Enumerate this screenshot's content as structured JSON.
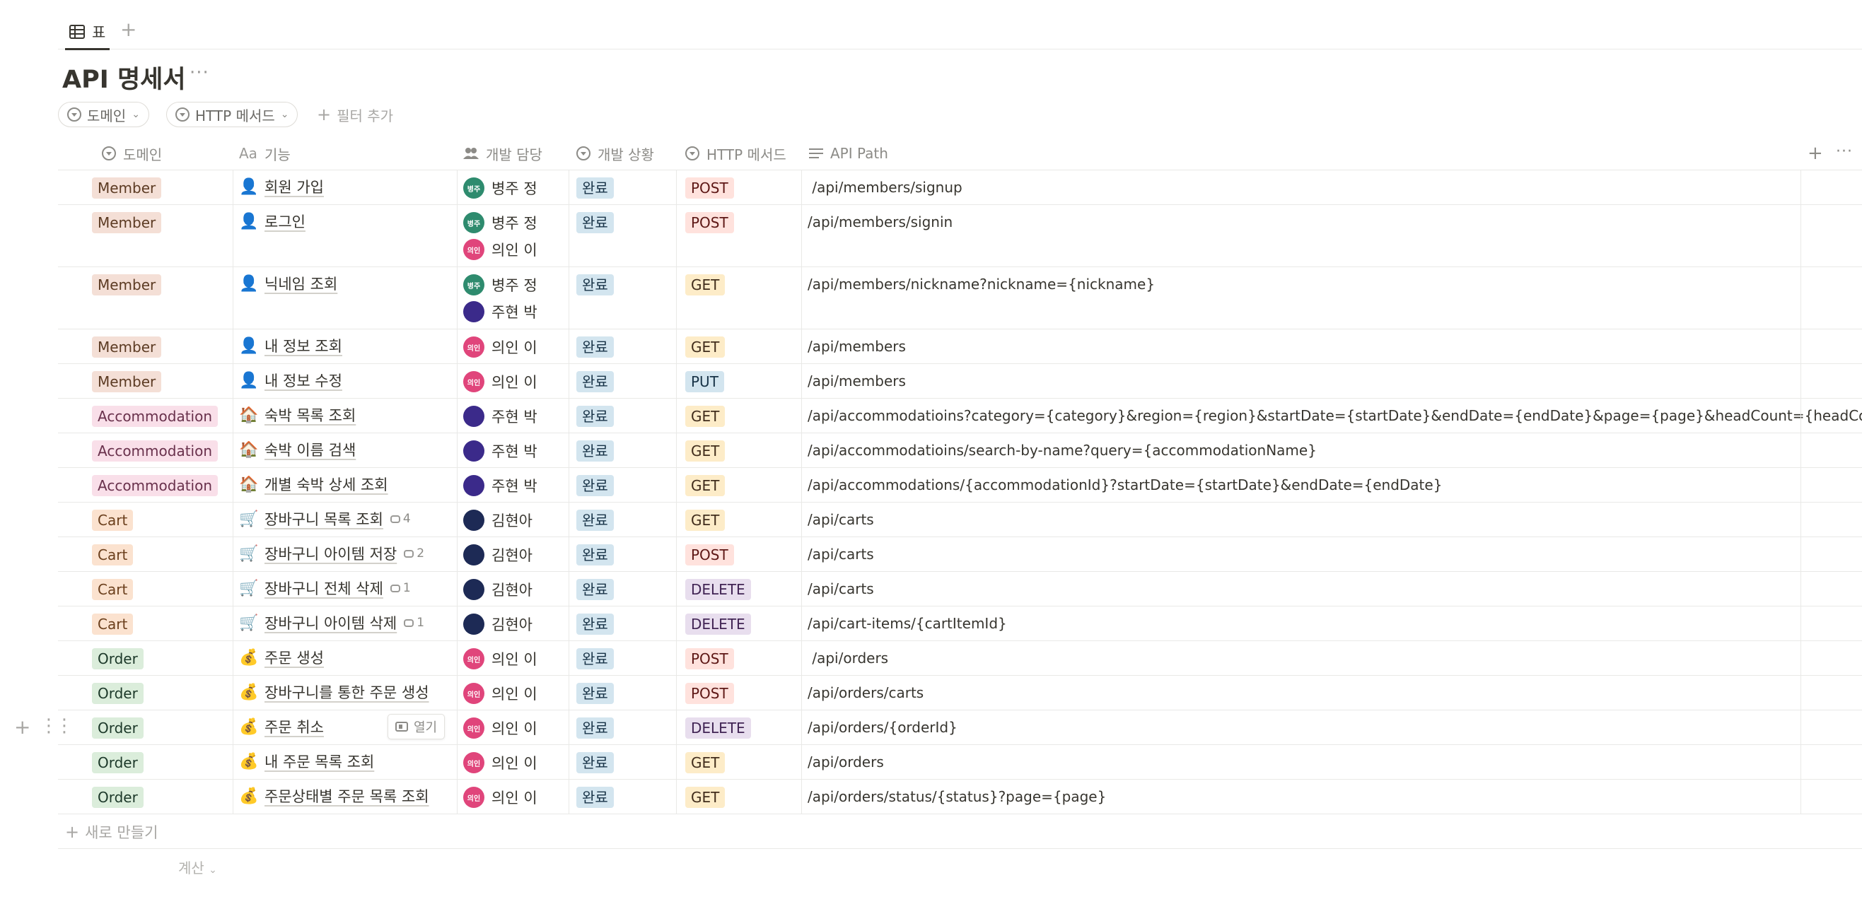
{
  "view": {
    "tab_label": "표",
    "add": "+"
  },
  "page": {
    "title": "API 명세서",
    "more": "···"
  },
  "filters": [
    {
      "label": "도메인"
    },
    {
      "label": "HTTP 메서드"
    }
  ],
  "add_filter": "필터 추가",
  "columns": [
    {
      "label": "도메인",
      "icon": "select-icon"
    },
    {
      "label": "기능",
      "prefix": "Aa",
      "icon": "title-icon"
    },
    {
      "label": "개발 담당",
      "icon": "people-icon"
    },
    {
      "label": "개발 상황",
      "icon": "select-icon"
    },
    {
      "label": "HTTP 메서드",
      "icon": "select-icon"
    },
    {
      "label": "API Path",
      "icon": "text-icon"
    }
  ],
  "people": {
    "jung": {
      "name": "병주 정",
      "initials": "병주",
      "color": "#2e8b6e"
    },
    "lee": {
      "name": "의인 이",
      "initials": "의인",
      "color": "#e0457b"
    },
    "park": {
      "name": "주현 박",
      "initials": "",
      "color": "#3b2a8a"
    },
    "kim": {
      "name": "김현아",
      "initials": "",
      "color": "#1d2a55"
    }
  },
  "domain_colors": {
    "Member": {
      "bg": "#f4dfd6",
      "fg": "#5c3b23"
    },
    "Accommodation": {
      "bg": "#f9dfe9",
      "fg": "#69314c"
    },
    "Cart": {
      "bg": "#fbe2cf",
      "fg": "#6b3f1c"
    },
    "Order": {
      "bg": "#dbeddb",
      "fg": "#1c3829"
    }
  },
  "method_colors": {
    "POST": {
      "bg": "#ffe2dd",
      "fg": "#5d1715"
    },
    "GET": {
      "bg": "#fdecc8",
      "fg": "#402c1b"
    },
    "PUT": {
      "bg": "#d3e5ef",
      "fg": "#183347"
    },
    "DELETE": {
      "bg": "#e8deee",
      "fg": "#412454"
    }
  },
  "status_color": {
    "bg": "#d3e5ef",
    "fg": "#183347"
  },
  "rows": [
    {
      "domain": "Member",
      "emoji": "👤",
      "name": "회원 가입",
      "devs": [
        "jung"
      ],
      "status": "완료",
      "method": "POST",
      "path": " /api/members/signup"
    },
    {
      "domain": "Member",
      "emoji": "👤",
      "name": "로그인",
      "devs": [
        "jung",
        "lee"
      ],
      "status": "완료",
      "method": "POST",
      "path": "/api/members/signin"
    },
    {
      "domain": "Member",
      "emoji": "👤",
      "name": "닉네임 조회",
      "devs": [
        "jung",
        "park"
      ],
      "status": "완료",
      "method": "GET",
      "path": "/api/members/nickname?nickname={nickname}"
    },
    {
      "domain": "Member",
      "emoji": "👤",
      "name": "내 정보 조회",
      "devs": [
        "lee"
      ],
      "status": "완료",
      "method": "GET",
      "path": "/api/members"
    },
    {
      "domain": "Member",
      "emoji": "👤",
      "name": "내 정보 수정",
      "devs": [
        "lee"
      ],
      "status": "완료",
      "method": "PUT",
      "path": "/api/members"
    },
    {
      "domain": "Accommodation",
      "emoji": "🏠",
      "name": "숙박 목록 조회",
      "devs": [
        "park"
      ],
      "status": "완료",
      "method": "GET",
      "path": "/api/accommodatioins?category={category}&region={region}&startDate={startDate}&endDate={endDate}&page={page}&headCount={headCount}"
    },
    {
      "domain": "Accommodation",
      "emoji": "🏠",
      "name": "숙박 이름 검색",
      "devs": [
        "park"
      ],
      "status": "완료",
      "method": "GET",
      "path": "/api/accommodatioins/search-by-name?query={accommodationName}"
    },
    {
      "domain": "Accommodation",
      "emoji": "🏠",
      "name": "개별 숙박 상세 조회",
      "devs": [
        "park"
      ],
      "status": "완료",
      "method": "GET",
      "path": "/api/accommodations/{accommodationId}?startDate={startDate}&endDate={endDate}"
    },
    {
      "domain": "Cart",
      "emoji": "🛒",
      "name": "장바구니 목록 조회",
      "comments": "4",
      "devs": [
        "kim"
      ],
      "status": "완료",
      "method": "GET",
      "path": "/api/carts"
    },
    {
      "domain": "Cart",
      "emoji": "🛒",
      "name": "장바구니 아이템 저장",
      "comments": "2",
      "devs": [
        "kim"
      ],
      "status": "완료",
      "method": "POST",
      "path": "/api/carts"
    },
    {
      "domain": "Cart",
      "emoji": "🛒",
      "name": "장바구니 전체 삭제",
      "comments": "1",
      "devs": [
        "kim"
      ],
      "status": "완료",
      "method": "DELETE",
      "path": "/api/carts"
    },
    {
      "domain": "Cart",
      "emoji": "🛒",
      "name": "장바구니 아이템 삭제",
      "comments": "1",
      "devs": [
        "kim"
      ],
      "status": "완료",
      "method": "DELETE",
      "path": "/api/cart-items/{cartItemId}"
    },
    {
      "domain": "Order",
      "emoji": "💰",
      "name": "주문 생성",
      "devs": [
        "lee"
      ],
      "status": "완료",
      "method": "POST",
      "path": " /api/orders"
    },
    {
      "domain": "Order",
      "emoji": "💰",
      "name": "장바구니를 통한 주문 생성",
      "devs": [
        "lee"
      ],
      "status": "완료",
      "method": "POST",
      "path": "/api/orders/carts"
    },
    {
      "domain": "Order",
      "emoji": "💰",
      "name": "주문 취소",
      "devs": [
        "lee"
      ],
      "status": "완료",
      "method": "DELETE",
      "path": "/api/orders/{orderId}"
    },
    {
      "domain": "Order",
      "emoji": "💰",
      "name": "내 주문 목록 조회",
      "devs": [
        "lee"
      ],
      "status": "완료",
      "method": "GET",
      "path": "/api/orders"
    },
    {
      "domain": "Order",
      "emoji": "💰",
      "name": "주문상태별 주문 목록 조회",
      "devs": [
        "lee"
      ],
      "status": "완료",
      "method": "GET",
      "path": "/api/orders/status/{status}?page={page}"
    }
  ],
  "open_button": "열기",
  "new_row": "새로 만들기",
  "calculate": "계산"
}
